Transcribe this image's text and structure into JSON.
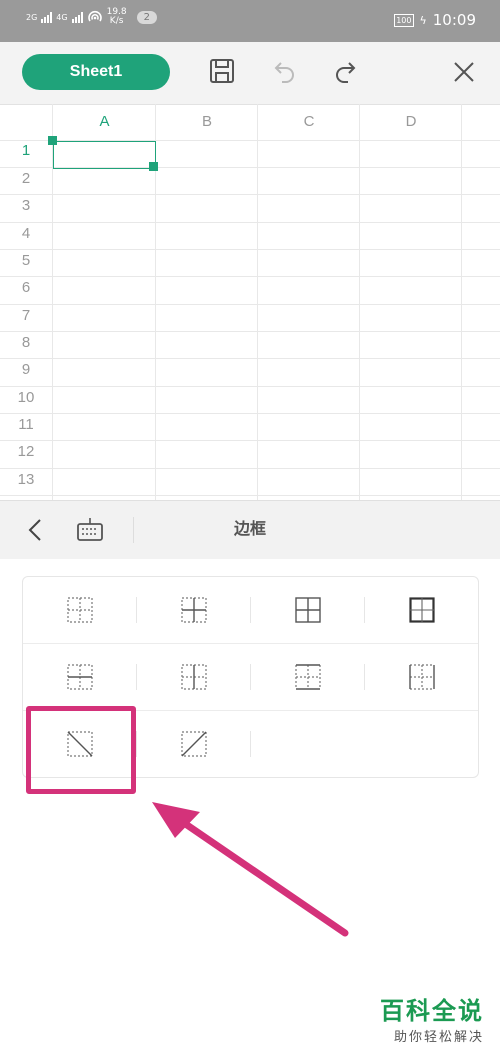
{
  "status_bar": {
    "net1": "2G",
    "net2": "4G",
    "speed_value": "19.8",
    "speed_unit": "K/s",
    "notif_count": "2",
    "battery": "100",
    "time": "10:09"
  },
  "toolbar": {
    "sheet_name": "Sheet1"
  },
  "grid": {
    "columns": [
      "A",
      "B",
      "C",
      "D"
    ],
    "rows": [
      "1",
      "2",
      "3",
      "4",
      "5",
      "6",
      "7",
      "8",
      "9",
      "10",
      "11",
      "12",
      "13"
    ],
    "selected_cell": "A1"
  },
  "panel": {
    "title": "边框"
  },
  "border_options": [
    {
      "icon": "all-dotted-border-icon"
    },
    {
      "icon": "inner-border-icon"
    },
    {
      "icon": "all-borders-icon"
    },
    {
      "icon": "thick-outer-border-icon"
    },
    {
      "icon": "horizontal-inner-border-icon"
    },
    {
      "icon": "vertical-inner-border-icon"
    },
    {
      "icon": "top-bottom-border-icon"
    },
    {
      "icon": "left-right-border-icon"
    },
    {
      "icon": "diagonal-down-border-icon"
    },
    {
      "icon": "diagonal-up-border-icon"
    }
  ],
  "colors": {
    "accent": "#1fa37a",
    "highlight": "#d4327a",
    "watermark": "#1b9a52"
  },
  "watermark": {
    "big": "百科全说",
    "small": "助你轻松解决"
  }
}
